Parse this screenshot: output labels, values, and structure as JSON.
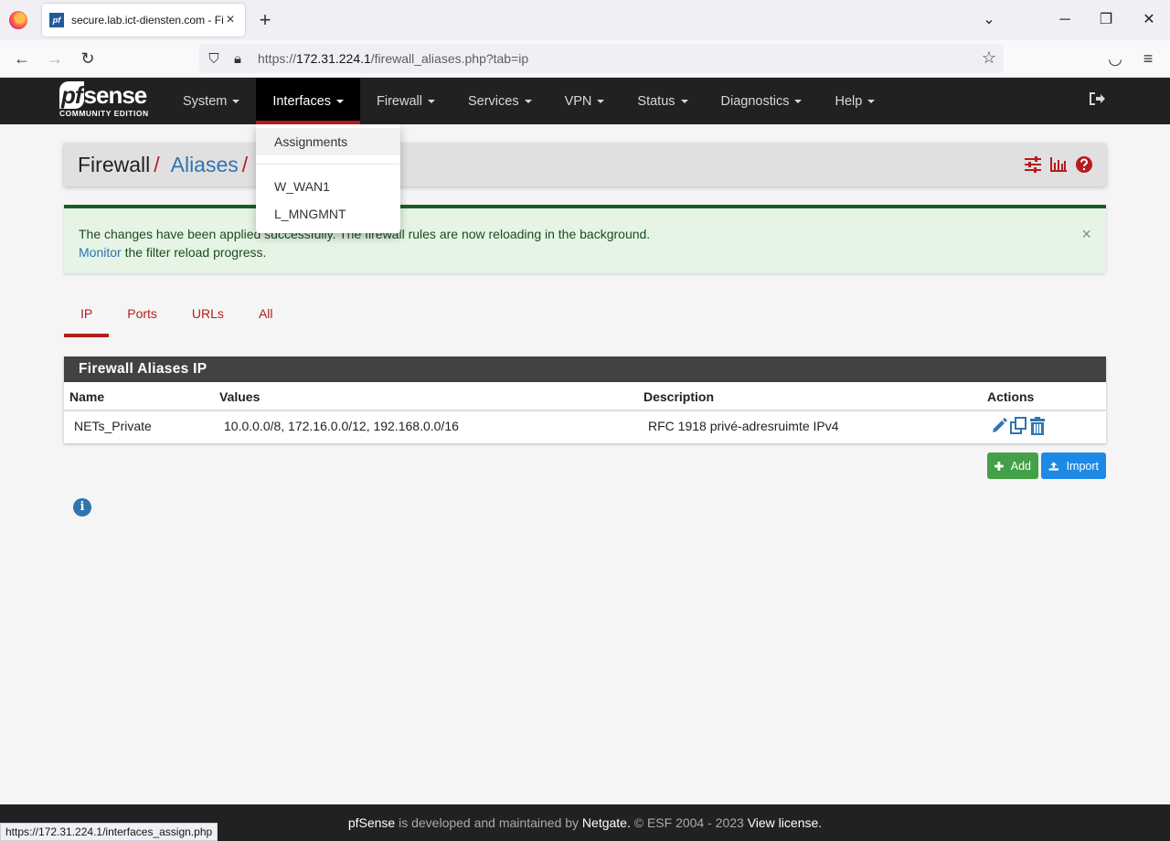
{
  "browser": {
    "tab_title": "secure.lab.ict-diensten.com - Fi",
    "favicon_text": "pf",
    "url_scheme": "https://",
    "url_host": "172.31.224.1",
    "url_path": "/firewall_aliases.php?tab=ip",
    "status_url": "https://172.31.224.1/interfaces_assign.php"
  },
  "header": {
    "logo_pf": "pf",
    "logo_sense": "sense",
    "edition": "COMMUNITY EDITION",
    "menu": [
      "System",
      "Interfaces",
      "Firewall",
      "Services",
      "VPN",
      "Status",
      "Diagnostics",
      "Help"
    ],
    "active_menu": "Interfaces"
  },
  "dropdown": {
    "items": [
      "Assignments",
      "W_WAN1",
      "L_MNGMNT"
    ]
  },
  "breadcrumb": {
    "part1": "Firewall",
    "part2": "Aliases",
    "sep": "/"
  },
  "alert": {
    "message": "The changes have been applied successfully. The firewall rules are now reloading in the background.",
    "link": "Monitor",
    "message2": " the filter reload progress.",
    "close": "×"
  },
  "tabs": [
    "IP",
    "Ports",
    "URLs",
    "All"
  ],
  "table": {
    "title": "Firewall Aliases IP",
    "columns": [
      "Name",
      "Values",
      "Description",
      "Actions"
    ],
    "rows": [
      {
        "name": "NETs_Private",
        "values": "10.0.0.0/8, 172.16.0.0/12, 192.168.0.0/16",
        "description": "RFC 1918 privé-adresruimte IPv4"
      }
    ]
  },
  "buttons": {
    "add": "Add",
    "import": "Import"
  },
  "info_icon": "i",
  "footer": {
    "brand": "pfSense",
    "text1": " is developed and maintained by ",
    "company": "Netgate.",
    "text2": " © ESF 2004 - 2023 ",
    "license": "View license."
  },
  "colors": {
    "accent": "#b71c1c",
    "link": "#3174b2",
    "nav_bg": "#212121",
    "success": "#43a047",
    "primary": "#1e88e5"
  }
}
